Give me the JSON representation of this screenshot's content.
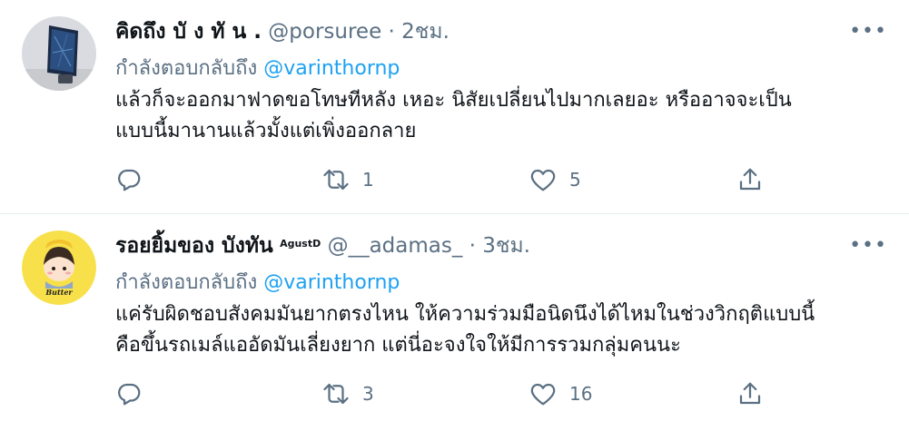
{
  "tweets": [
    {
      "name": "คิดถึง บั ง ทั น .",
      "name_sup": "",
      "handle": "@porsuree",
      "separator": "·",
      "time": "2ชม.",
      "reply_prefix": "กำลังตอบกลับถึง",
      "reply_to": "@varinthornp",
      "text_line1": "แล้วก็จะออกมาฟาดขอโทษทีหลัง เหอะ นิสัยเปลี่ยนไปมากเลยอะ หรืออาจจะเป็น",
      "text_line2": "แบบนี้มานานแล้วมั้งแต่เพิ่งออกลาย",
      "retweets": "1",
      "likes": "5",
      "more_label": "•••",
      "icons": [
        "reply-icon",
        "retweet-icon",
        "like-icon",
        "share-icon",
        "more-icon"
      ]
    },
    {
      "name": "รอยยิ้มของ บังทัน",
      "name_sup": "AgustD",
      "handle": "@__adamas_",
      "separator": "·",
      "time": "3ชม.",
      "reply_prefix": "กำลังตอบกลับถึง",
      "reply_to": "@varinthornp",
      "text_line1": "แค่รับผิดชอบสังคมมันยากตรงไหน ให้ความร่วมมือนิดนึงได้ไหมในช่วงวิกฤติแบบนี้",
      "text_line2": "คือขึ้นรถเมล์แออัดมันเลี่ยงยาก แต่นี่อะจงใจให้มีการรวมกลุ่มคนนะ",
      "retweets": "3",
      "likes": "16",
      "more_label": "•••",
      "avatar_text": "Butter",
      "icons": [
        "reply-icon",
        "retweet-icon",
        "like-icon",
        "share-icon",
        "more-icon"
      ]
    }
  ],
  "colors": {
    "link": "#1da1f2",
    "secondary": "#5b7083",
    "text": "#0f1419",
    "divider": "#e6ecf0"
  }
}
